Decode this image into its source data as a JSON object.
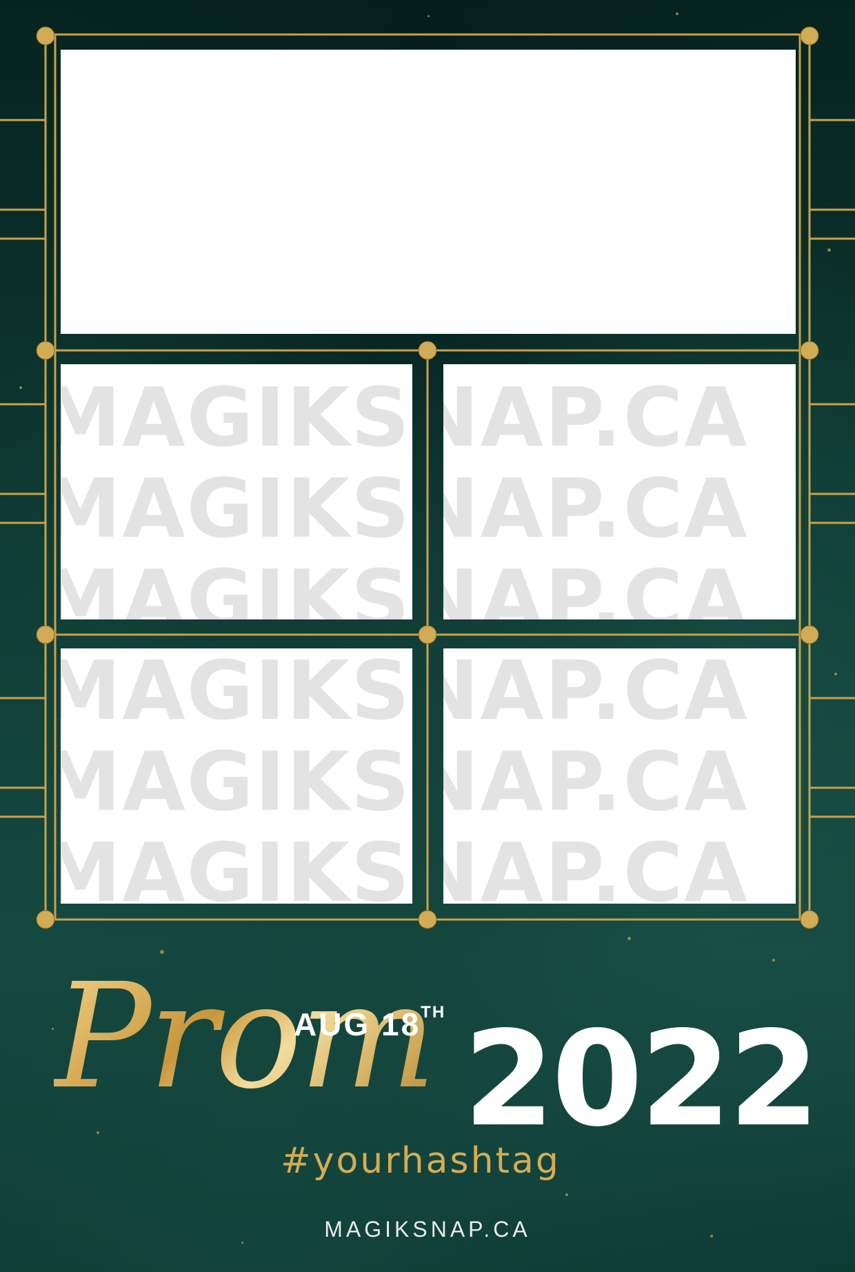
{
  "colors": {
    "background": "#0f3b35",
    "gold": "#d4ac55",
    "slot": "#ffffff",
    "watermark": "#e3e3e3",
    "text_white": "#ffffff"
  },
  "watermark": "MAGIKSNAP.CA",
  "event": {
    "title": "Prom",
    "date_main": "AUG 18",
    "date_suffix": "TH",
    "year": "2022",
    "hashtag": "#yourhashtag"
  },
  "footer": {
    "brand": "MAGIKSNAP.CA"
  },
  "photo_slots": 5
}
